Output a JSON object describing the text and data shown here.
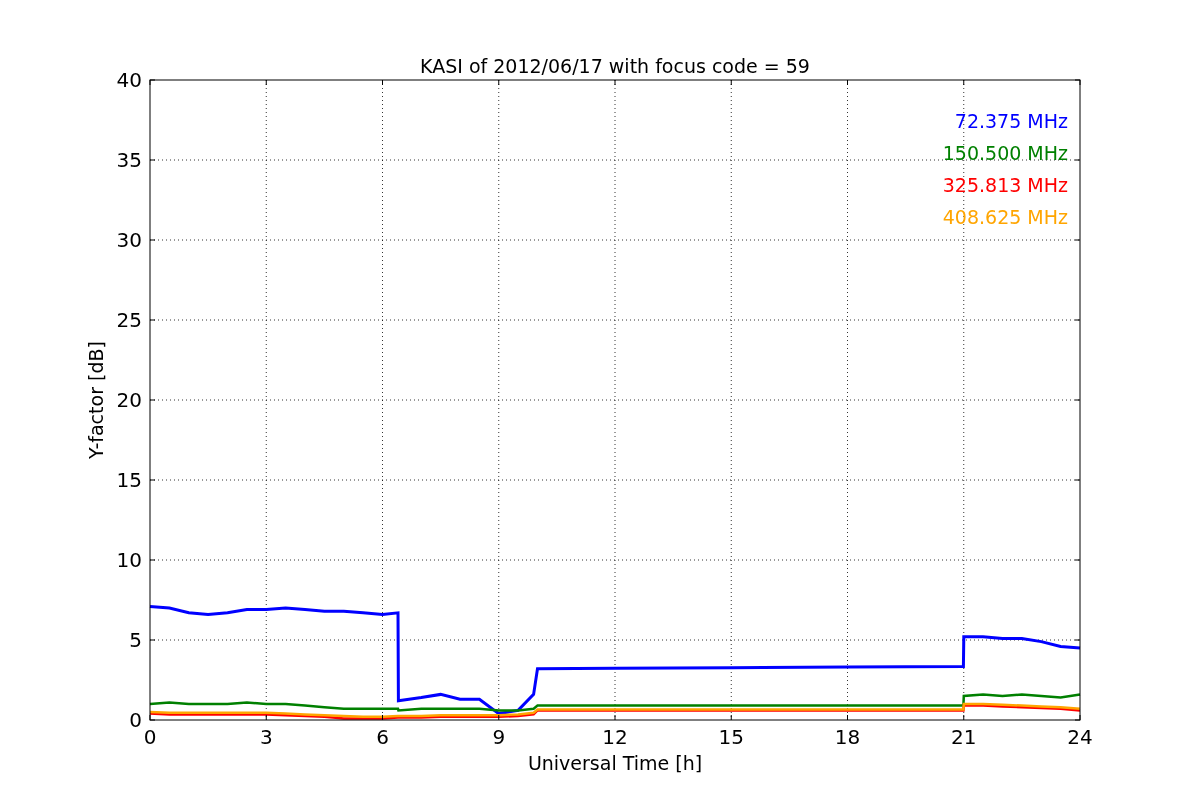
{
  "chart_data": {
    "type": "line",
    "title": "KASI of 2012/06/17 with focus code = 59",
    "xlabel": "Universal Time [h]",
    "ylabel": "Y-factor [dB]",
    "x": [
      0,
      0.5,
      1,
      1.5,
      2,
      2.5,
      3,
      3.5,
      4,
      4.5,
      5,
      5.5,
      6,
      6.4,
      6.41,
      7,
      7.5,
      8,
      8.5,
      9,
      9.5,
      9.9,
      10,
      12,
      15,
      18,
      20.99,
      21,
      21.5,
      22,
      22.5,
      23,
      23.5,
      24
    ],
    "series": [
      {
        "name": "72.375 MHz",
        "color": "#0000ff",
        "values": [
          7.1,
          7.0,
          6.7,
          6.6,
          6.7,
          6.9,
          6.9,
          7.0,
          6.9,
          6.8,
          6.8,
          6.7,
          6.6,
          6.7,
          1.2,
          1.4,
          1.6,
          1.3,
          1.3,
          0.4,
          0.6,
          1.6,
          3.2,
          3.23,
          3.27,
          3.31,
          3.35,
          5.2,
          5.2,
          5.1,
          5.1,
          4.9,
          4.6,
          4.5
        ]
      },
      {
        "name": "150.500 MHz",
        "color": "#008000",
        "values": [
          1.0,
          1.1,
          1.0,
          1.0,
          1.0,
          1.1,
          1.0,
          1.0,
          0.9,
          0.8,
          0.7,
          0.7,
          0.7,
          0.7,
          0.6,
          0.7,
          0.7,
          0.7,
          0.7,
          0.6,
          0.6,
          0.7,
          0.9,
          0.9,
          0.9,
          0.9,
          0.9,
          1.5,
          1.6,
          1.5,
          1.6,
          1.5,
          1.4,
          1.6
        ]
      },
      {
        "name": "325.813 MHz",
        "color": "#ff0000",
        "values": [
          0.4,
          0.35,
          0.35,
          0.35,
          0.35,
          0.35,
          0.35,
          0.3,
          0.25,
          0.2,
          0.1,
          0.1,
          0.1,
          0.15,
          0.15,
          0.15,
          0.2,
          0.2,
          0.2,
          0.2,
          0.25,
          0.35,
          0.6,
          0.6,
          0.6,
          0.6,
          0.6,
          0.9,
          0.9,
          0.85,
          0.8,
          0.75,
          0.7,
          0.6
        ]
      },
      {
        "name": "408.625 MHz",
        "color": "#ffa500",
        "values": [
          0.5,
          0.45,
          0.45,
          0.45,
          0.45,
          0.45,
          0.45,
          0.4,
          0.35,
          0.3,
          0.25,
          0.2,
          0.2,
          0.25,
          0.25,
          0.25,
          0.3,
          0.3,
          0.3,
          0.3,
          0.35,
          0.45,
          0.65,
          0.65,
          0.65,
          0.65,
          0.65,
          1.0,
          1.0,
          0.95,
          0.9,
          0.85,
          0.8,
          0.7
        ]
      }
    ],
    "grid": true,
    "xlim": [
      0,
      24
    ],
    "ylim": [
      0,
      40
    ],
    "xticks": [
      0,
      3,
      6,
      9,
      12,
      15,
      18,
      21,
      24
    ],
    "yticks": [
      0,
      5,
      10,
      15,
      20,
      25,
      30,
      35,
      40
    ]
  }
}
